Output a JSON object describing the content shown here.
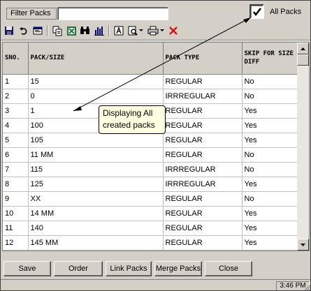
{
  "filter": {
    "label": "Filter Packs",
    "value": ""
  },
  "all_packs": {
    "label": "All Packs",
    "checked": true
  },
  "toolbar": {
    "icons": [
      "save-icon",
      "undo-icon",
      "window-icon",
      "copy-icon",
      "excel-icon",
      "find-icon",
      "chart-icon",
      "font-icon",
      "print-preview-icon",
      "print-icon",
      "delete-icon"
    ]
  },
  "grid": {
    "columns": [
      "SNO.",
      "PACK/SIZE",
      "PACK TYPE",
      "SKIP FOR SIZE DIFF"
    ],
    "rows": [
      [
        "1",
        "15",
        "REGULAR",
        "No"
      ],
      [
        "2",
        "0",
        "IRRREGULAR",
        "No"
      ],
      [
        "3",
        "1",
        "REGULAR",
        "Yes"
      ],
      [
        "4",
        "100",
        "REGULAR",
        "Yes"
      ],
      [
        "5",
        "105",
        "REGULAR",
        "Yes"
      ],
      [
        "6",
        "11 MM",
        "REGULAR",
        "No"
      ],
      [
        "7",
        "115",
        "IRRREGULAR",
        "No"
      ],
      [
        "8",
        "125",
        "IRRREGULAR",
        "Yes"
      ],
      [
        "9",
        "XX",
        "REGULAR",
        "No"
      ],
      [
        "10",
        "14 MM",
        "REGULAR",
        "Yes"
      ],
      [
        "11",
        "140",
        "REGULAR",
        "Yes"
      ],
      [
        "12",
        "145 MM",
        "REGULAR",
        "Yes"
      ]
    ]
  },
  "tooltip": {
    "line1": "Displaying All",
    "line2": "created packs"
  },
  "buttons": {
    "save": "Save",
    "order": "Order",
    "link_packs": "Link Packs",
    "merge_packs": "Merge Packs",
    "close": "Close"
  },
  "status": {
    "time": "3:46 PM"
  }
}
